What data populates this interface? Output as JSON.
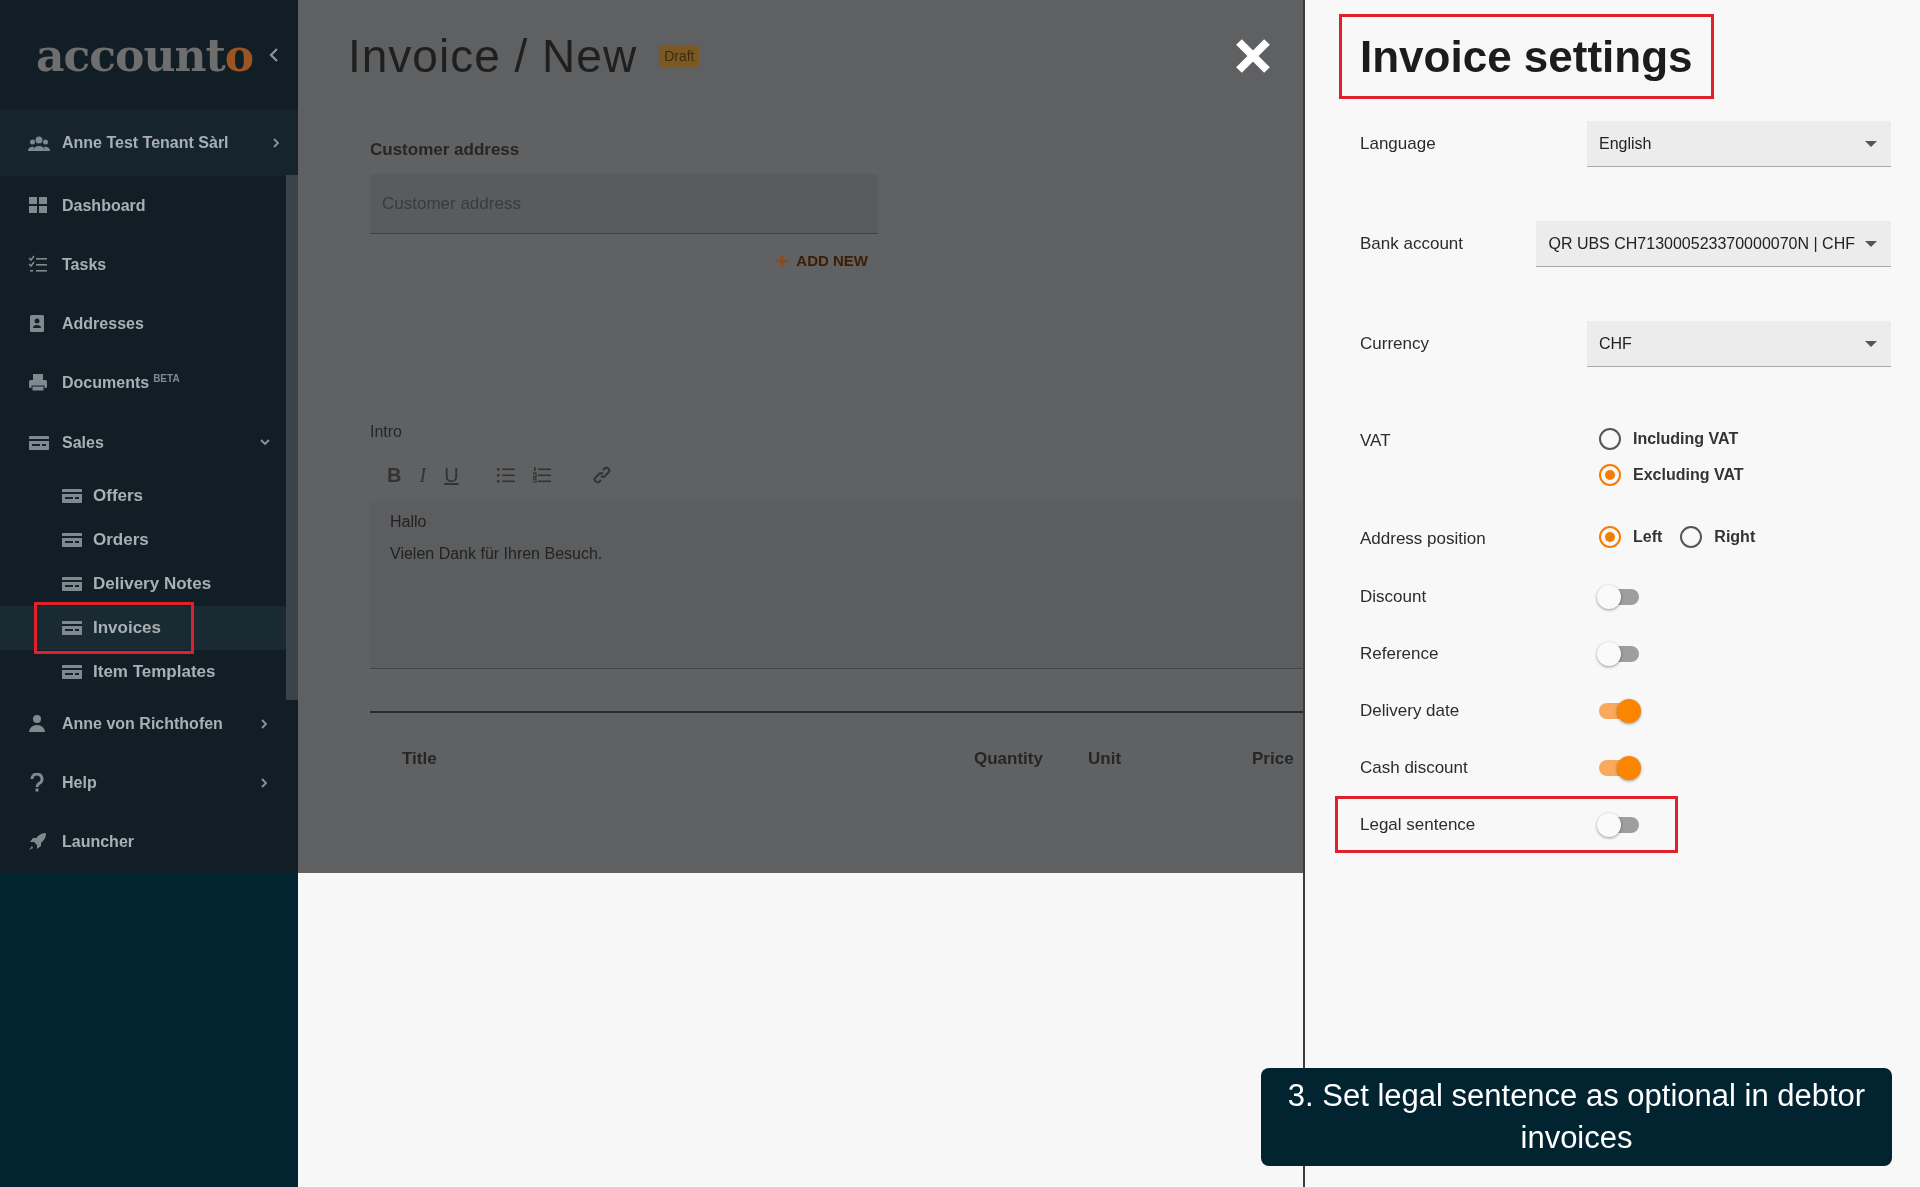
{
  "sidebar": {
    "logo": {
      "text": "account",
      "accent": "o"
    },
    "items": [
      {
        "label": "Anne Test Tenant Sàrl",
        "kind": "account",
        "selected": false
      },
      {
        "label": "Dashboard",
        "kind": "link",
        "selected": false
      },
      {
        "label": "Tasks",
        "kind": "link",
        "selected": false
      },
      {
        "label": "Addresses",
        "kind": "link",
        "selected": false
      },
      {
        "label": "Documents",
        "kind": "link",
        "badge": "BETA",
        "selected": false
      },
      {
        "label": "Sales",
        "kind": "group",
        "expanded": true,
        "selected": false,
        "children": [
          {
            "label": "Offers",
            "selected": false,
            "highlighted": false
          },
          {
            "label": "Orders",
            "selected": false,
            "highlighted": false
          },
          {
            "label": "Delivery Notes",
            "selected": false,
            "highlighted": false
          },
          {
            "label": "Invoices",
            "selected": true,
            "highlighted": true
          },
          {
            "label": "Item Templates",
            "selected": false,
            "highlighted": false
          }
        ]
      },
      {
        "label": "Anne von Richthofen",
        "kind": "menu",
        "selected": false
      },
      {
        "label": "Help",
        "kind": "menu",
        "selected": false
      },
      {
        "label": "Launcher",
        "kind": "link",
        "selected": false
      }
    ]
  },
  "editor": {
    "title": "Invoice / New",
    "status": "Draft",
    "customer_address": {
      "label": "Customer address",
      "placeholder": "Customer address"
    },
    "add_new": "ADD NEW",
    "intro": {
      "label": "Intro",
      "toolbar": [
        {
          "kind": "bold",
          "label": "B"
        },
        {
          "kind": "italic",
          "label": "I"
        },
        {
          "kind": "underline",
          "label": "U"
        },
        {
          "kind": "bullets"
        },
        {
          "kind": "numbers"
        },
        {
          "kind": "link"
        }
      ],
      "lines": [
        "Hallo",
        "Vielen Dank für Ihren Besuch."
      ]
    },
    "table": {
      "columns": [
        "Title",
        "Quantity",
        "Unit",
        "Price"
      ]
    }
  },
  "settings": {
    "title": "Invoice settings",
    "highlighted": true,
    "rows": [
      {
        "kind": "select",
        "label": "Language",
        "value": "English"
      },
      {
        "kind": "select",
        "label": "Bank account",
        "value": "QR UBS CH713000523370000070N | CHF"
      },
      {
        "kind": "select",
        "label": "Currency",
        "value": "CHF"
      },
      {
        "kind": "radiocolumn",
        "label": "VAT",
        "options": [
          {
            "label": "Including VAT",
            "selected": false
          },
          {
            "label": "Excluding VAT",
            "selected": true
          }
        ]
      },
      {
        "kind": "radiorow",
        "label": "Address position",
        "options": [
          {
            "label": "Left",
            "selected": true
          },
          {
            "label": "Right",
            "selected": false
          }
        ]
      },
      {
        "kind": "toggle",
        "label": "Discount",
        "on": false,
        "highlighted": false
      },
      {
        "kind": "toggle",
        "label": "Reference",
        "on": false,
        "highlighted": false
      },
      {
        "kind": "toggle",
        "label": "Delivery date",
        "on": true,
        "highlighted": false
      },
      {
        "kind": "toggle",
        "label": "Cash discount",
        "on": true,
        "highlighted": false
      },
      {
        "kind": "toggle",
        "label": "Legal sentence",
        "on": false,
        "highlighted": true
      }
    ]
  },
  "caption": "3. Set legal sentence as optional in debtor invoices"
}
